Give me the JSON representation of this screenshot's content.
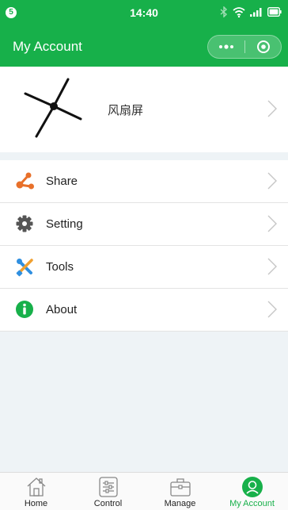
{
  "status_bar": {
    "notification_count": "5",
    "time": "14:40"
  },
  "header": {
    "title": "My Account"
  },
  "profile": {
    "device_name": "风扇屏"
  },
  "menu": {
    "items": [
      {
        "label": "Share",
        "icon": "share-icon",
        "color": "#e8702a"
      },
      {
        "label": "Setting",
        "icon": "gear-icon",
        "color": "#555555"
      },
      {
        "label": "Tools",
        "icon": "tools-icon",
        "color": "#2f8fe0"
      },
      {
        "label": "About",
        "icon": "info-icon",
        "color": "#17b04a"
      }
    ]
  },
  "tabs": [
    {
      "label": "Home",
      "icon": "home-icon",
      "active": false
    },
    {
      "label": "Control",
      "icon": "control-sliders-icon",
      "active": false
    },
    {
      "label": "Manage",
      "icon": "briefcase-icon",
      "active": false
    },
    {
      "label": "My Account",
      "icon": "account-icon",
      "active": true
    }
  ],
  "colors": {
    "brand_green": "#17b04a",
    "background": "#eef3f6"
  }
}
